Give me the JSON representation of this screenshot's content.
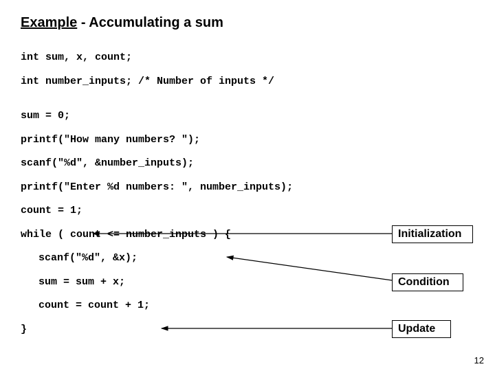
{
  "title": {
    "underlined": "Example",
    "rest": " - Accumulating a sum"
  },
  "code": {
    "l1": "int sum, x, count;",
    "l2": "int number_inputs; /* Number of inputs */",
    "l3": "sum = 0;",
    "l4": "printf(\"How many numbers? \");",
    "l5": "scanf(\"%d\", &number_inputs);",
    "l6": "printf(\"Enter %d numbers: \", number_inputs);",
    "l7": "count = 1;",
    "l8": "while ( count <= number_inputs ) {",
    "l9": "scanf(\"%d\", &x);",
    "l10": "sum = sum + x;",
    "l11": "count = count + 1;",
    "l12": "}"
  },
  "callouts": {
    "init": "Initialization",
    "cond": "Condition",
    "upd": "Update"
  },
  "page_number": "12"
}
